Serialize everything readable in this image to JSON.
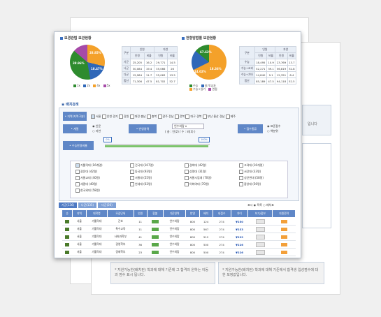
{
  "left_chart": {
    "title": "보경관법 보관현황",
    "slices": [
      {
        "label": "28.85%",
        "color": "#f4a12a",
        "percent": 28.85
      },
      {
        "label": "18.47%",
        "color": "#2f67b8",
        "percent": 18.47
      },
      {
        "label": "38.96%",
        "color": "#2e8b2e",
        "percent": 38.96
      },
      {
        "label": "",
        "color": "#a64aa8",
        "percent": 13.72
      }
    ],
    "legend": [
      "1x",
      "2x",
      "4x",
      "5x"
    ]
  },
  "left_table": {
    "headers": [
      "구분",
      "인원",
      "",
      "자연",
      ""
    ],
    "subheaders": [
      "",
      "인원",
      "비율",
      "인원",
      "비율"
    ],
    "rows": [
      [
        "가군",
        "25,205",
        "16.2",
        "29,771",
        "14.5"
      ],
      [
        "나군",
        "30,084",
        "19.4",
        "35,066",
        "26"
      ],
      [
        "다군",
        "15,984",
        "11.7",
        "35,063",
        "13.5"
      ],
      [
        "합산",
        "71,306",
        "47.5",
        "81,702",
        "52.7"
      ]
    ]
  },
  "right_chart": {
    "title": "전형방법별 보관현황",
    "slices": [
      {
        "label": "67.62%",
        "color": "#f4a12a",
        "percent": 67.62
      },
      {
        "label": "18.36%",
        "color": "#2f67b8",
        "percent": 18.36
      },
      {
        "label": "14.02%",
        "color": "#2e8b2e",
        "percent": 14.02
      }
    ],
    "legend": [
      "수능",
      "실기/교과",
      "수능+실기",
      "면접"
    ]
  },
  "right_table": {
    "headers": [
      "구분",
      "인원",
      "",
      "자연",
      ""
    ],
    "subheaders": [
      "",
      "인원",
      "비율",
      "인원",
      "비율"
    ],
    "rows": [
      [
        "수능",
        "18,495",
        "10.9",
        "23,769",
        "13.7"
      ],
      [
        "수능+교과",
        "52,271",
        "39.1",
        "56,819",
        "32.8"
      ],
      [
        "수능+기타",
        "14,840",
        "9.1",
        "12,351",
        "8.4"
      ],
      [
        "합산",
        "85,189",
        "47.5",
        "94,118",
        "52.5"
      ]
    ]
  },
  "search": {
    "title": "배치검색",
    "region_label": "• 지역(지역구분)",
    "regions": [
      "서울",
      "인천 경기",
      "강원",
      "대전 충남",
      "충북",
      "광주 전남",
      "전북",
      "대구 경북",
      "부산 울산 경남",
      "제주"
    ],
    "track_label": "• 계열",
    "track_options": [
      "인문",
      "자연"
    ],
    "area_label": "• 반영영역",
    "area_select": "언수외탐",
    "area_sub": "( 총 : 언(2) / 수 : 외(3) )",
    "score_label": "• 점수종류",
    "score_options": [
      "표준점수",
      "백분위"
    ],
    "pct_label": "• 수능반영비율",
    "slider_min": "0%",
    "slider_max": "100%",
    "slider_value": 1.0,
    "schools": [
      "가톨릭대 (16개명)",
      "건국대 (107명)",
      "경희대 (42명)",
      "고려대 (16개명)",
      "광운대 (42명)",
      "동국대 (93명)",
      "상명대 (31명)",
      "서강대 (33명)",
      "서울교대 (40명)",
      "서울대 (55명)",
      "서울시립대 (70명)",
      "성균관대 (58명)",
      "세종대 (40명)",
      "연세대 (63명)",
      "이화여대 (70명)",
      "중앙대 (56명)",
      "한국외대 (58명)"
    ]
  },
  "tabs": [
    "가군(136)",
    "나군(135)",
    "다군(26)"
  ],
  "result_controls": {
    "label": "표시",
    "options": [
      "목록",
      "배치표"
    ]
  },
  "results": {
    "headers": [
      "순",
      "지역",
      "대학명",
      "모집단위",
      "인원",
      "합불",
      "기준영역",
      "반영",
      "배치",
      "내점수",
      "차이",
      "보기/합보",
      "지원전략"
    ],
    "rows": [
      [
        "1",
        "서울",
        "가톨릭대",
        "간호",
        "11",
        "",
        "언수외탐",
        "800",
        "124",
        "274",
        "▼250",
        "",
        ""
      ],
      [
        "2",
        "서울",
        "가톨릭대",
        "특수교육",
        "11",
        "",
        "언수외탐",
        "800",
        "567",
        "274",
        "▼233",
        "",
        ""
      ],
      [
        "3",
        "서울",
        "가톨릭대",
        "사회과학부",
        "41",
        "",
        "언수외탐",
        "800",
        "512",
        "274",
        "▼229",
        "",
        ""
      ],
      [
        "4",
        "서울",
        "가톨릭대",
        "경영학부",
        "36",
        "",
        "언수외탐",
        "800",
        "500",
        "274",
        "▼226",
        "",
        ""
      ],
      [
        "5",
        "서울",
        "가톨릭대",
        "경제학부",
        "23",
        "",
        "언수외탐",
        "800",
        "500",
        "274",
        "▼226",
        "",
        ""
      ],
      [
        "6",
        "서울",
        "가톨릭대",
        "국제학부",
        "7",
        "",
        "언수외탐",
        "800",
        "496",
        "274",
        "▼221",
        "",
        ""
      ],
      [
        "7",
        "서울",
        "가톨릭대",
        "법학부",
        "13",
        "",
        "언수외탐",
        "800",
        "496",
        "274",
        "▼220",
        "",
        ""
      ]
    ]
  },
  "back_notes": {
    "left": "* 지원가능한(배치된) 학과에 대해 기존에 그 합격의 원하는 이동과 점수 표시 됩니다.",
    "right": "* 지원가능한(배치된) 학과에 대해 기준에서 합격생 입성점수에 대한 모정값입니다.",
    "side": "입니다"
  }
}
